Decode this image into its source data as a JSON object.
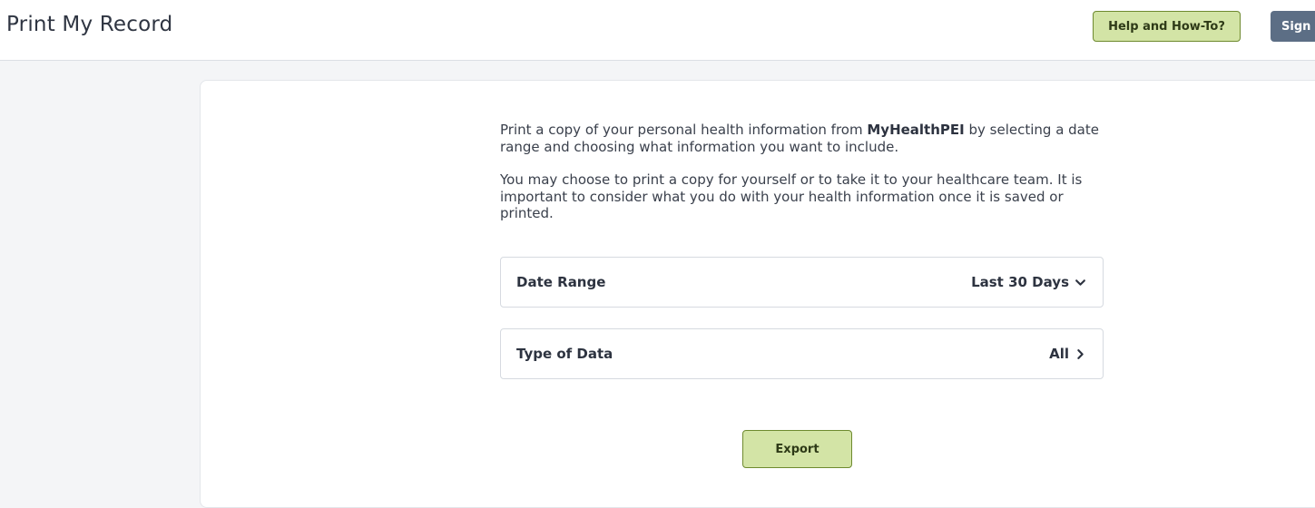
{
  "header": {
    "title": "Print My Record",
    "help_label": "Help and How-To?",
    "sign_label": "Sign"
  },
  "intro": {
    "p1_before": "Print a copy of your personal health information from ",
    "p1_brand": "MyHealthPEI",
    "p1_after": " by selecting a date range and choosing what information you want to include.",
    "p2": "You may choose to print a copy for yourself or to take it to your healthcare team. It is important to consider what you do with your health information once it is saved or printed."
  },
  "options": {
    "date_range": {
      "label": "Date Range",
      "value": "Last 30 Days",
      "icon": "chevron-down-icon"
    },
    "type_of_data": {
      "label": "Type of Data",
      "value": "All",
      "icon": "chevron-right-icon"
    }
  },
  "actions": {
    "export_label": "Export"
  },
  "colors": {
    "primary_button_bg": "#d3e4a6",
    "primary_button_border": "#6e8a2f",
    "secondary_button_bg": "#5c6e85"
  }
}
